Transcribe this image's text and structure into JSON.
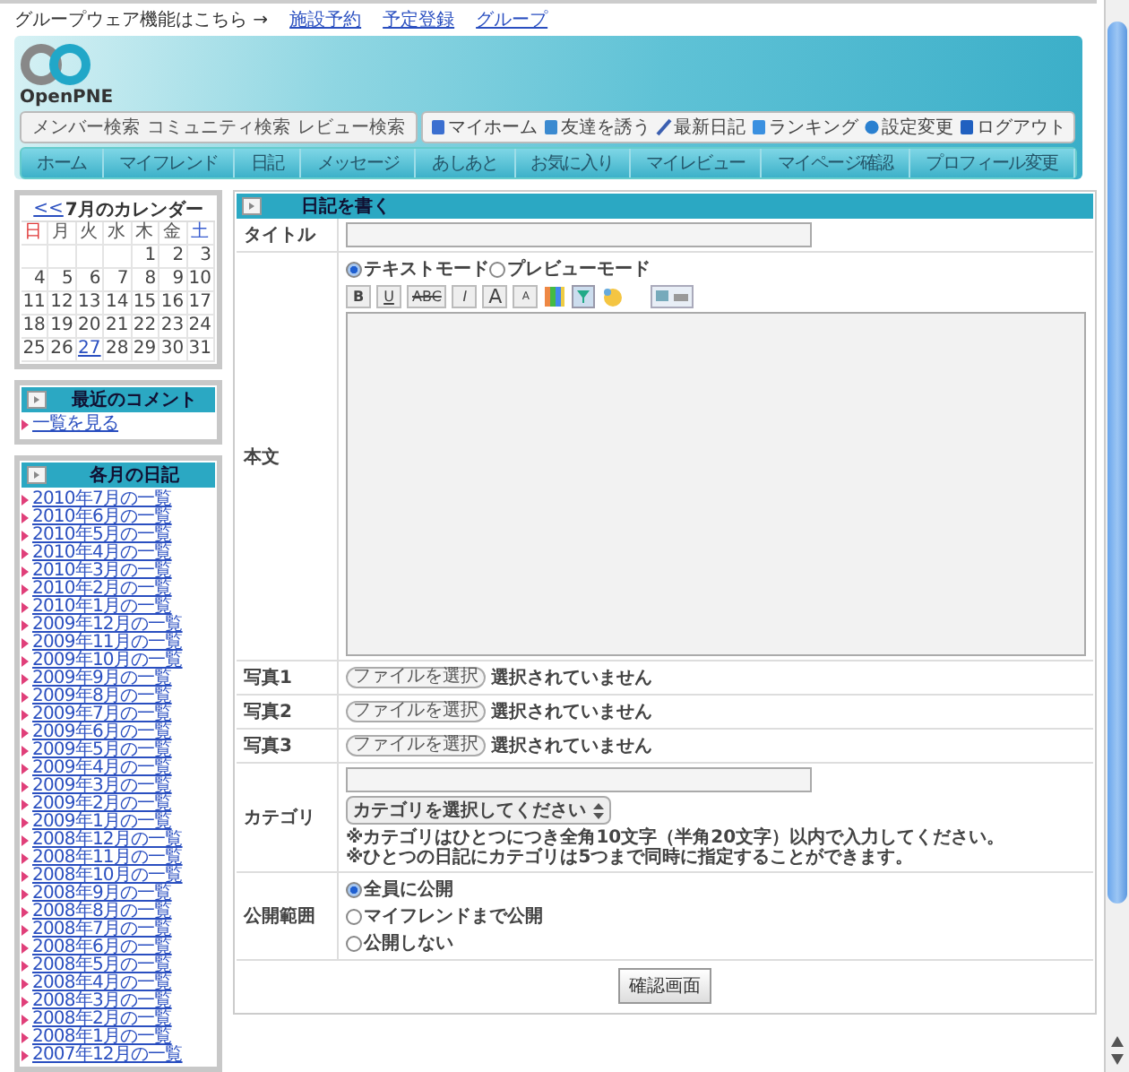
{
  "topbar": {
    "label": "グループウェア機能はこちら →",
    "links": [
      "施設予約",
      "予定登録",
      "グループ"
    ]
  },
  "header": {
    "logo": "OpenPNE",
    "search_tabs": [
      "メンバー検索",
      "コミュニティ検索",
      "レビュー検索"
    ],
    "links": [
      "マイホーム",
      "友達を誘う",
      "最新日記",
      "ランキング",
      "設定変更",
      "ログアウト"
    ],
    "nav": [
      "ホーム",
      "マイフレンド",
      "日記",
      "メッセージ",
      "あしあと",
      "お気に入り",
      "マイレビュー",
      "マイページ確認",
      "プロフィール変更"
    ]
  },
  "calendar": {
    "prev": "<<",
    "title": "7月のカレンダー",
    "weekdays": [
      {
        "label": "日",
        "color": "#e03a3a"
      },
      {
        "label": "月",
        "color": "#555555"
      },
      {
        "label": "火",
        "color": "#555555"
      },
      {
        "label": "水",
        "color": "#555555"
      },
      {
        "label": "木",
        "color": "#555555"
      },
      {
        "label": "金",
        "color": "#555555"
      },
      {
        "label": "土",
        "color": "#3a5ed0"
      }
    ],
    "weeks": [
      [
        {
          "day": "1",
          "today": false
        },
        {
          "day": "2",
          "today": false
        },
        {
          "day": "3",
          "today": false
        }
      ],
      [
        {
          "day": "4",
          "today": false
        },
        {
          "day": "5",
          "today": false
        },
        {
          "day": "6",
          "today": false
        },
        {
          "day": "7",
          "today": false
        },
        {
          "day": "8",
          "today": false
        },
        {
          "day": "9",
          "today": false
        },
        {
          "day": "10",
          "today": false
        }
      ],
      [
        {
          "day": "11",
          "today": false
        },
        {
          "day": "12",
          "today": false
        },
        {
          "day": "13",
          "today": false
        },
        {
          "day": "14",
          "today": false
        },
        {
          "day": "15",
          "today": false
        },
        {
          "day": "16",
          "today": false
        },
        {
          "day": "17",
          "today": false
        }
      ],
      [
        {
          "day": "18",
          "today": false
        },
        {
          "day": "19",
          "today": false
        },
        {
          "day": "20",
          "today": false
        },
        {
          "day": "21",
          "today": false
        },
        {
          "day": "22",
          "today": false
        },
        {
          "day": "23",
          "today": false
        },
        {
          "day": "24",
          "today": false
        }
      ],
      [
        {
          "day": "25",
          "today": false
        },
        {
          "day": "26",
          "today": false
        },
        {
          "day": "27",
          "today": true
        },
        {
          "day": "28",
          "today": false
        },
        {
          "day": "29",
          "today": false
        },
        {
          "day": "30",
          "today": false
        },
        {
          "day": "31",
          "today": false
        }
      ]
    ]
  },
  "comments": {
    "title": "最近のコメント",
    "link": "一覧を見る"
  },
  "monthly": {
    "title": "各月の日記",
    "items": [
      "2010年7月の一覧",
      "2010年6月の一覧",
      "2010年5月の一覧",
      "2010年4月の一覧",
      "2010年3月の一覧",
      "2010年2月の一覧",
      "2010年1月の一覧",
      "2009年12月の一覧",
      "2009年11月の一覧",
      "2009年10月の一覧",
      "2009年9月の一覧",
      "2009年8月の一覧",
      "2009年7月の一覧",
      "2009年6月の一覧",
      "2009年5月の一覧",
      "2009年4月の一覧",
      "2009年3月の一覧",
      "2009年2月の一覧",
      "2009年1月の一覧",
      "2008年12月の一覧",
      "2008年11月の一覧",
      "2008年10月の一覧",
      "2008年9月の一覧",
      "2008年8月の一覧",
      "2008年7月の一覧",
      "2008年6月の一覧",
      "2008年5月の一覧",
      "2008年4月の一覧",
      "2008年3月の一覧",
      "2008年2月の一覧",
      "2008年1月の一覧",
      "2007年12月の一覧"
    ]
  },
  "form": {
    "title": "日記を書く",
    "title_label": "タイトル",
    "body_label": "本文",
    "modes": [
      {
        "label": "テキストモード",
        "selected": true
      },
      {
        "label": "プレビューモード",
        "selected": false
      }
    ],
    "toolbar": [
      {
        "label": "B",
        "kind": "bold"
      },
      {
        "label": "U",
        "kind": "underline"
      },
      {
        "label": "ABC",
        "kind": "strike"
      },
      {
        "label": "I",
        "kind": "italic"
      },
      {
        "label": "A",
        "kind": "large"
      },
      {
        "label": "A",
        "kind": "small"
      }
    ],
    "photos": [
      {
        "label": "写真1",
        "button": "ファイルを選択",
        "status": "選択されていません"
      },
      {
        "label": "写真2",
        "button": "ファイルを選択",
        "status": "選択されていません"
      },
      {
        "label": "写真3",
        "button": "ファイルを選択",
        "status": "選択されていません"
      }
    ],
    "category": {
      "label": "カテゴリ",
      "select": "カテゴリを選択してください",
      "notes": [
        "※カテゴリはひとつにつき全角10文字（半角20文字）以内で入力してください。",
        "※ひとつの日記にカテゴリは5つまで同時に指定することができます。"
      ]
    },
    "visibility": {
      "label": "公開範囲",
      "options": [
        {
          "label": "全員に公開",
          "selected": true
        },
        {
          "label": "マイフレンドまで公開",
          "selected": false
        },
        {
          "label": "公開しない",
          "selected": false
        }
      ]
    },
    "submit": "確認画面"
  }
}
